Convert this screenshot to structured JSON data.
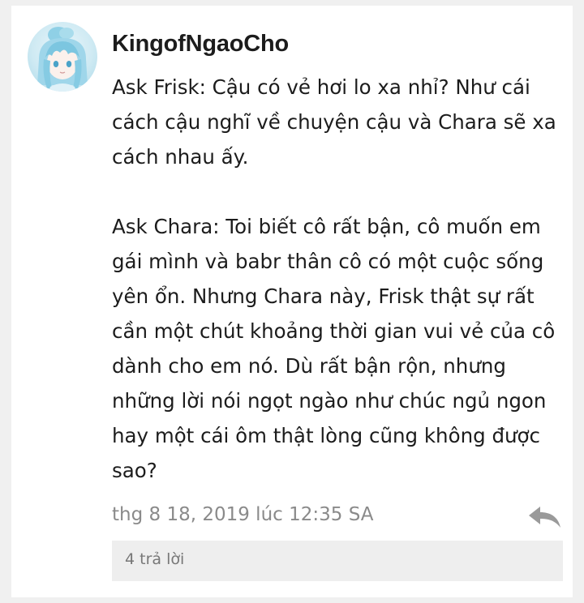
{
  "comment": {
    "username": "KingofNgaoCho",
    "paragraphs": [
      "Ask Frisk: Cậu có vẻ hơi lo xa nhỉ? Như cái cách cậu nghĩ về chuyện cậu và Chara sẽ xa cách nhau ấy.",
      "Ask Chara: Toi biết cô rất bận, cô muốn em gái mình và babr thân cô có một cuộc sống yên ổn. Nhưng Chara này, Frisk thật sự rất cần một chút khoảng thời gian vui vẻ của cô dành cho em nó. Dù rất bận rộn, nhưng những lời nói ngọt ngào như chúc ngủ ngon hay một cái ôm thật lòng cũng không được sao?"
    ],
    "timestamp": "thg 8 18, 2019 lúc 12:35 SA",
    "replies_label": "4 trả lời",
    "reply_icon": "reply-arrow-icon",
    "avatar": "anime-avatar-image"
  },
  "colors": {
    "text": "#1c1c1c",
    "meta_text": "#8a8a8a",
    "replies_bg": "#eeeeee",
    "page_bg": "#f0f0f0",
    "avatar_hair": "#8fd0e6"
  }
}
